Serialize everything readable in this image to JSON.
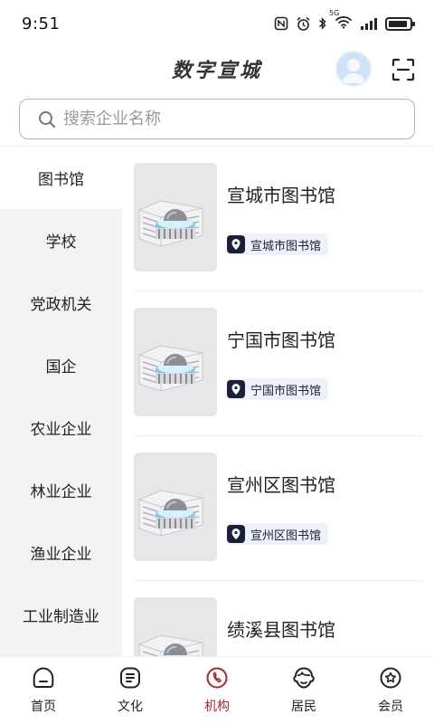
{
  "status_bar": {
    "time": "9:51",
    "network": "5G",
    "battery_level": 0.9
  },
  "header": {
    "title": "数字宣城"
  },
  "search": {
    "placeholder": "搜索企业名称"
  },
  "sidebar": {
    "items": [
      {
        "label": "图书馆",
        "active": true
      },
      {
        "label": "学校"
      },
      {
        "label": "党政机关"
      },
      {
        "label": "国企"
      },
      {
        "label": "农业企业"
      },
      {
        "label": "林业企业"
      },
      {
        "label": "渔业企业"
      },
      {
        "label": "工业制造业"
      }
    ]
  },
  "list": {
    "cards": [
      {
        "title": "宣城市图书馆",
        "tag": "宣城市图书馆"
      },
      {
        "title": "宁国市图书馆",
        "tag": "宁国市图书馆"
      },
      {
        "title": "宣州区图书馆",
        "tag": "宣州区图书馆"
      },
      {
        "title": "绩溪县图书馆",
        "tag": ""
      }
    ]
  },
  "bottom_nav": {
    "items": [
      {
        "label": "首页",
        "icon": "home-icon"
      },
      {
        "label": "文化",
        "icon": "culture-icon"
      },
      {
        "label": "机构",
        "icon": "institution-icon",
        "active": true
      },
      {
        "label": "居民",
        "icon": "residents-icon"
      },
      {
        "label": "会员",
        "icon": "member-icon"
      }
    ]
  },
  "colors": {
    "accent": "#b0262b",
    "tag_bg": "#eef2fb",
    "tag_dark": "#1b1f3a",
    "sidebar_bg": "#f3f3f3"
  }
}
